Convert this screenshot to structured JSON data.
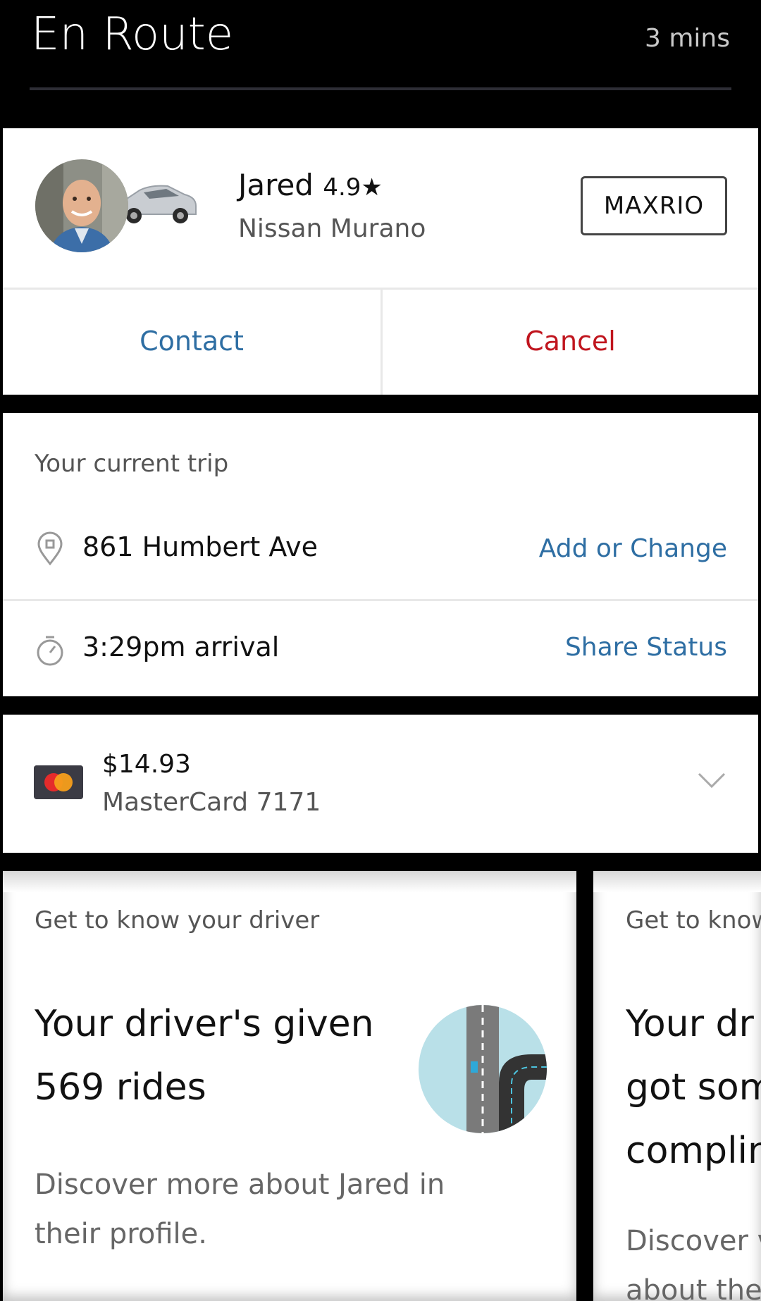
{
  "header": {
    "title": "En Route",
    "eta": "3 mins"
  },
  "driver": {
    "name": "Jared",
    "rating": "4.9★",
    "car": "Nissan Murano",
    "plate": "MAXRIO",
    "contact_label": "Contact",
    "cancel_label": "Cancel"
  },
  "trip": {
    "heading": "Your current trip",
    "destination": "861 Humbert Ave",
    "destination_action": "Add or Change",
    "arrival": "3:29pm arrival",
    "arrival_action": "Share Status"
  },
  "payment": {
    "amount": "$14.93",
    "card": "MasterCard 7171",
    "card_icon": "mastercard-icon",
    "expand_icon": "chevron-down-icon"
  },
  "promos": [
    {
      "kicker": "Get to know your driver",
      "headline_line1": "Your driver's given",
      "headline_line2": "569 rides",
      "body_line1": "Discover more about Jared in",
      "body_line2": "their profile."
    },
    {
      "kicker": "Get to know",
      "headline_line1": "Your dr",
      "headline_line2": "got som",
      "headline_line3": "complin",
      "body_line1": "Discover v",
      "body_line2": "about the"
    }
  ],
  "colors": {
    "link": "#2e6ea3",
    "danger": "#c0151e",
    "background": "#000000"
  }
}
